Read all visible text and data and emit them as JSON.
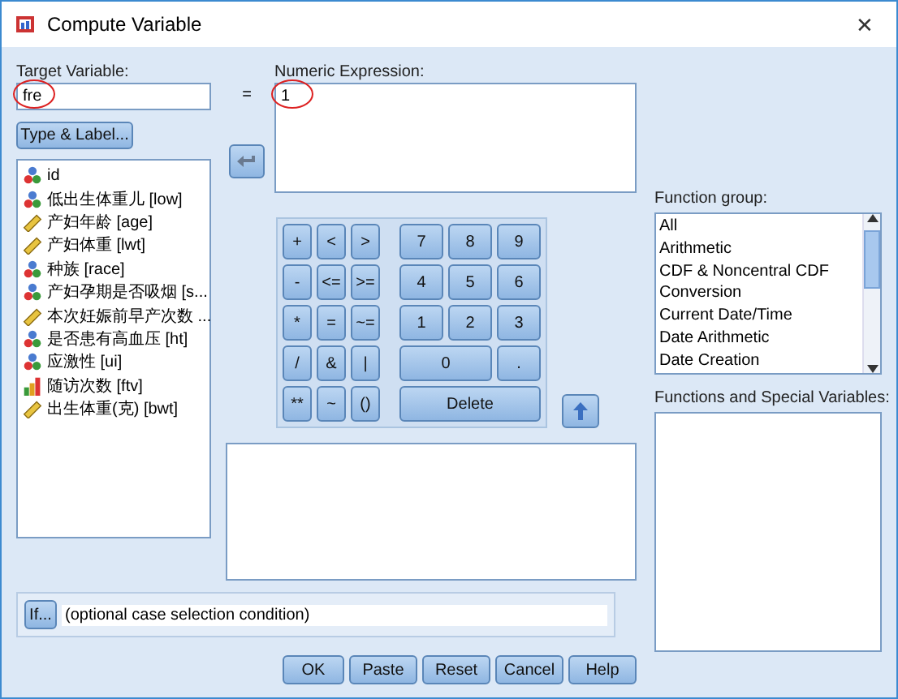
{
  "window": {
    "title": "Compute Variable",
    "close": "✕"
  },
  "target_variable": {
    "label": "Target Variable:",
    "value": "fre",
    "circled": true
  },
  "type_label_button": "Type & Label...",
  "equals": "=",
  "variables": [
    {
      "name": "id",
      "kind": "nominal"
    },
    {
      "name": "低出生体重儿 [low]",
      "kind": "nominal"
    },
    {
      "name": "产妇年龄 [age]",
      "kind": "scale"
    },
    {
      "name": "产妇体重 [lwt]",
      "kind": "scale"
    },
    {
      "name": "种族 [race]",
      "kind": "nominal"
    },
    {
      "name": "产妇孕期是否吸烟 [s...",
      "kind": "nominal"
    },
    {
      "name": "本次妊娠前早产次数 ...",
      "kind": "scale"
    },
    {
      "name": "是否患有高血压 [ht]",
      "kind": "nominal"
    },
    {
      "name": "应激性 [ui]",
      "kind": "nominal"
    },
    {
      "name": "随访次数 [ftv]",
      "kind": "ordinal"
    },
    {
      "name": "出生体重(克) [bwt]",
      "kind": "scale"
    }
  ],
  "numeric_expression": {
    "label": "Numeric Expression:",
    "value": "1",
    "circled": true
  },
  "keypad": [
    [
      "+",
      "<",
      ">",
      "7",
      "8",
      "9"
    ],
    [
      "-",
      "<=",
      ">=",
      "4",
      "5",
      "6"
    ],
    [
      "*",
      "=",
      "~=",
      "1",
      "2",
      "3"
    ],
    [
      "/",
      "&",
      "|",
      "0",
      "."
    ],
    [
      "**",
      "~",
      "()",
      "Delete"
    ]
  ],
  "function_group": {
    "label": "Function group:",
    "items": [
      "All",
      "Arithmetic",
      "CDF & Noncentral CDF",
      "Conversion",
      "Current Date/Time",
      "Date Arithmetic",
      "Date Creation"
    ]
  },
  "functions_label": "Functions and Special Variables:",
  "if_button": "If...",
  "if_condition": "(optional case selection condition)",
  "buttons": [
    "OK",
    "Paste",
    "Reset",
    "Cancel",
    "Help"
  ]
}
